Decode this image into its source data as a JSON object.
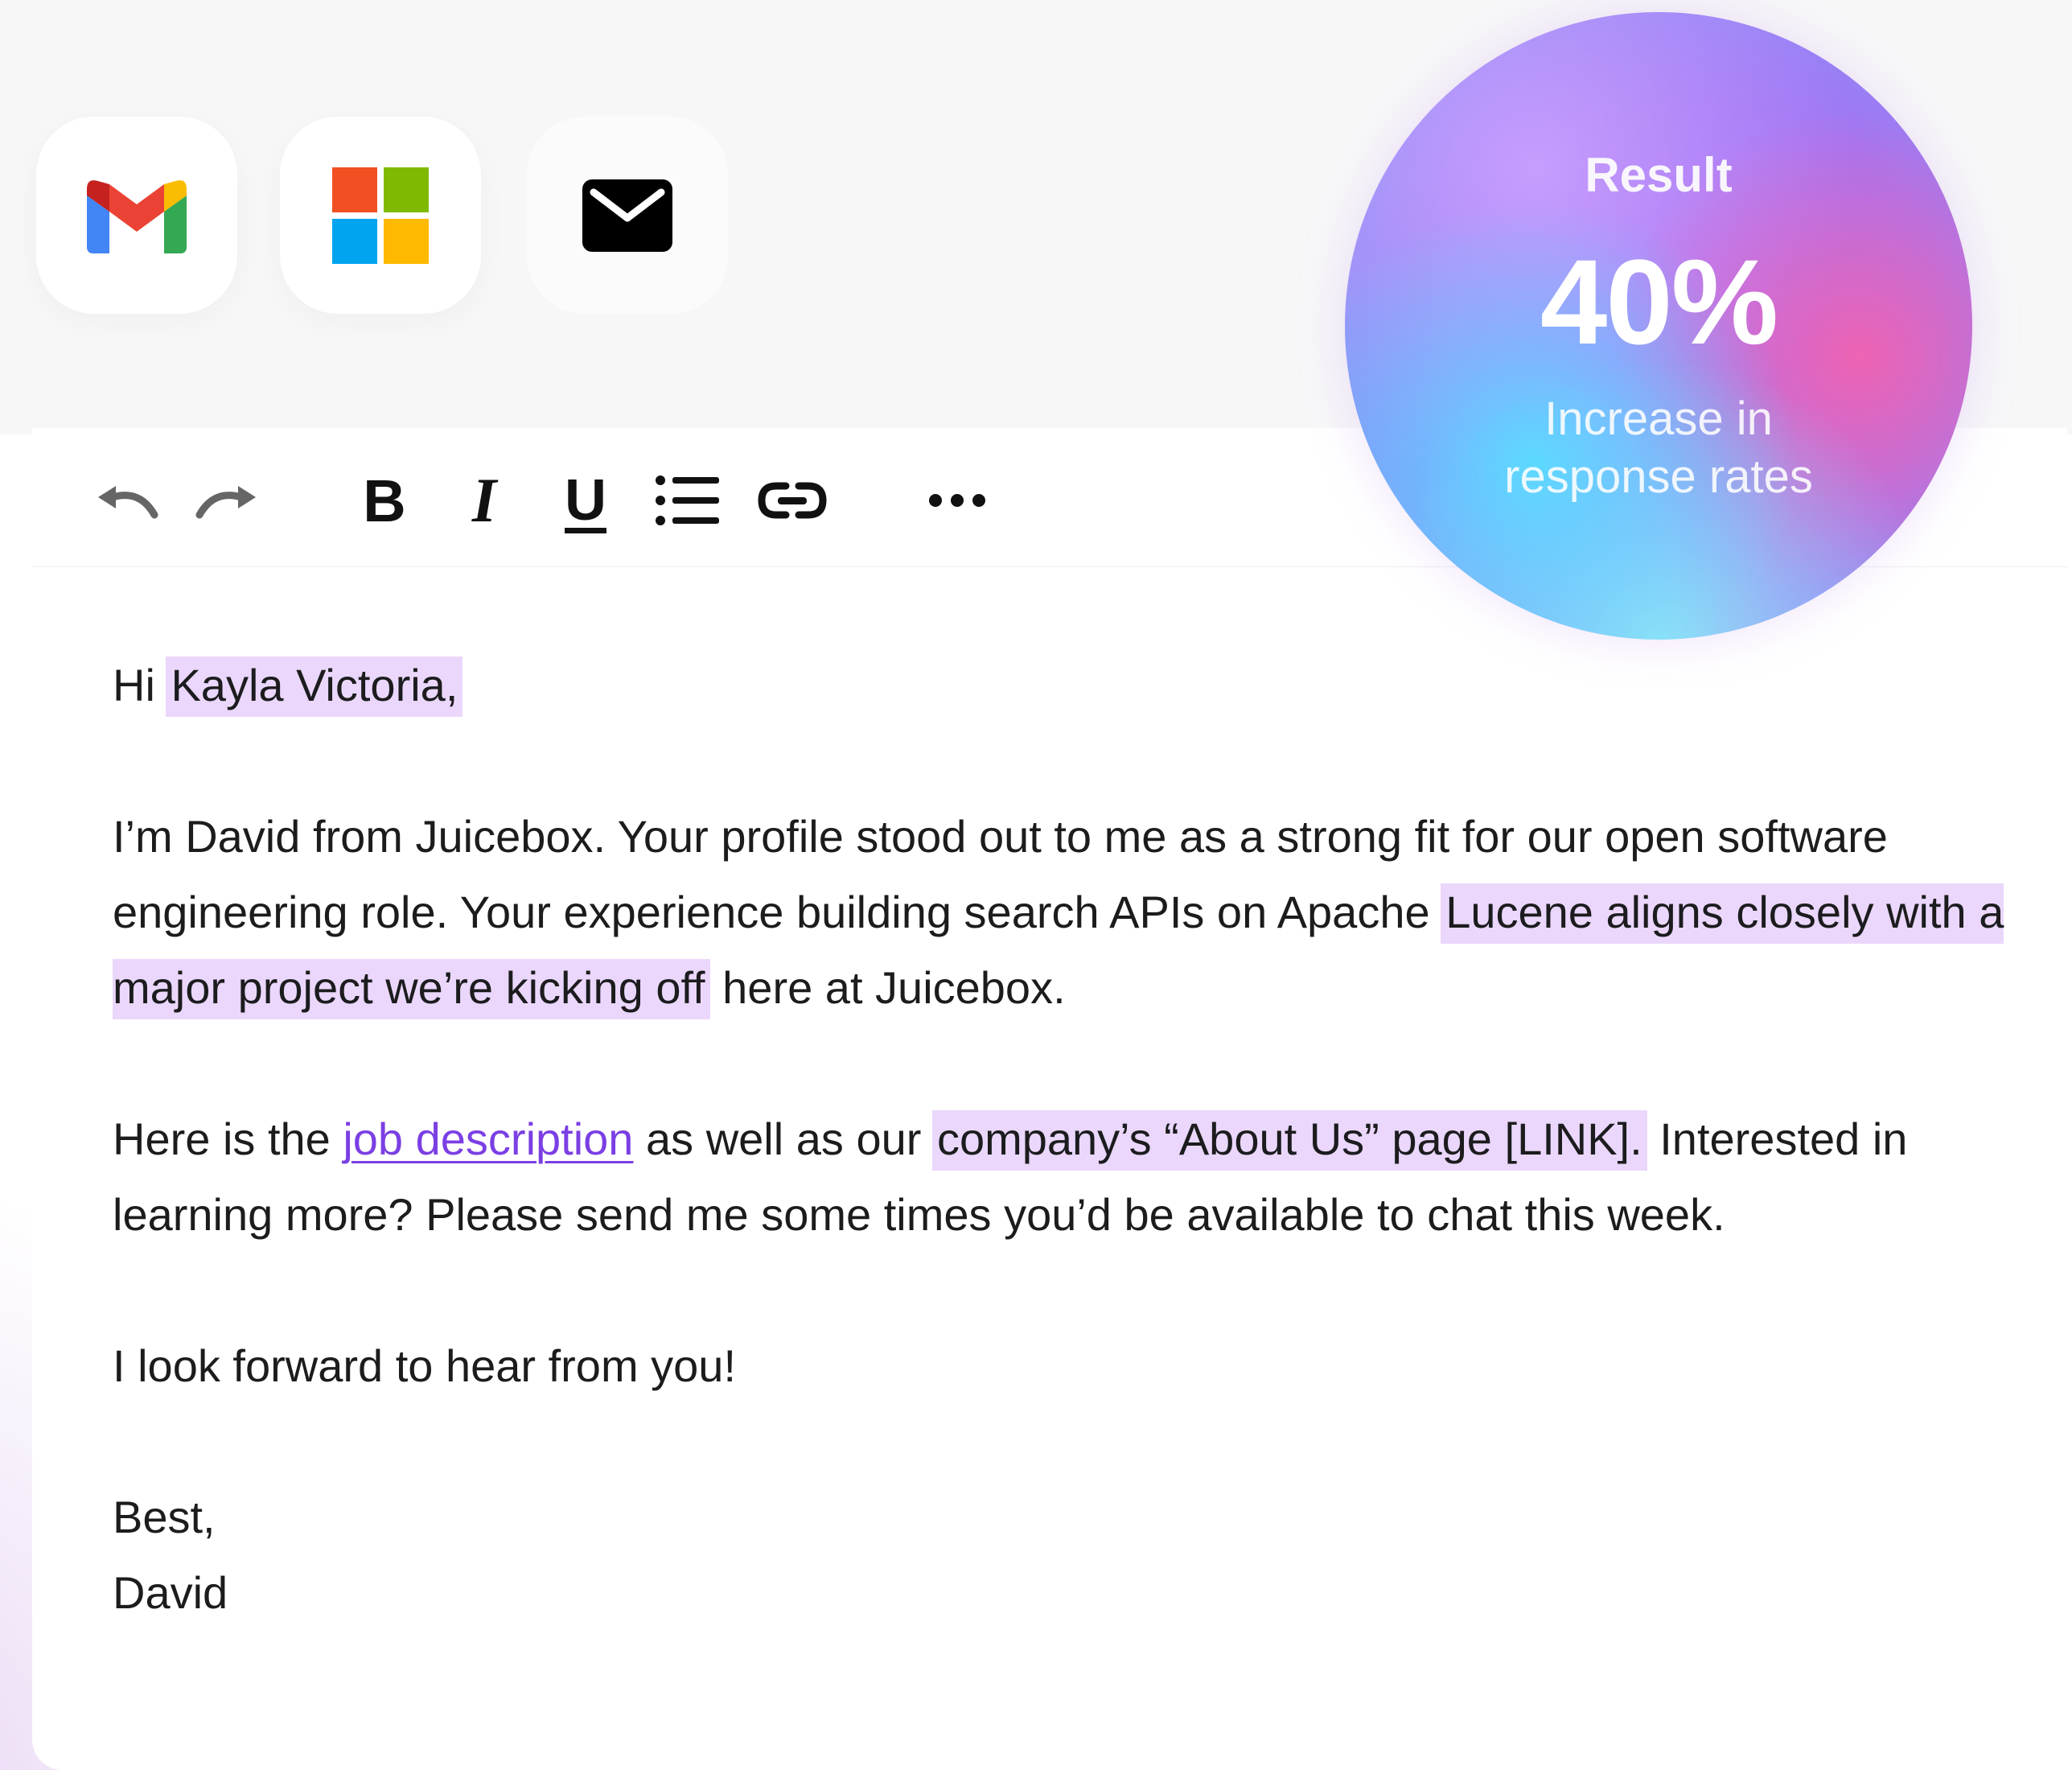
{
  "providers": [
    {
      "name": "gmail-icon"
    },
    {
      "name": "microsoft-icon"
    },
    {
      "name": "mail-icon"
    }
  ],
  "toolbar": {
    "tools": [
      "undo-icon",
      "redo-icon",
      "bold-icon",
      "italic-icon",
      "underline-icon",
      "bullet-list-icon",
      "link-icon",
      "more-icon"
    ],
    "bold_label": "B",
    "italic_label": "I",
    "underline_label": "U"
  },
  "email": {
    "greeting_prefix": "Hi ",
    "recipient": "Kayla Victoria,",
    "p1_a": "I’m David from Juicebox. Your profile stood out to me as a strong fit for our open software engineering role. Your experience building search APIs on Apache ",
    "p1_highlight": "Lucene aligns closely with a major project we’re kicking off",
    "p1_b": " here at Juicebox.",
    "p2_a": "Here is the ",
    "p2_link": "job description",
    "p2_b": " as well as our ",
    "p2_highlight": "company’s “About Us” page [LINK].",
    "p2_c": " Interested in learning more? Please send me some times you’d be available to chat this week.",
    "p3": "I look forward to hear from you!",
    "signoff": "Best,",
    "signature": "David"
  },
  "result": {
    "label": "Result",
    "value": "40%",
    "desc_line1": "Increase in",
    "desc_line2": "response rates"
  },
  "colors": {
    "highlight": "#ead7fb",
    "link": "#7b3fe4",
    "text": "#1c1c1e"
  }
}
